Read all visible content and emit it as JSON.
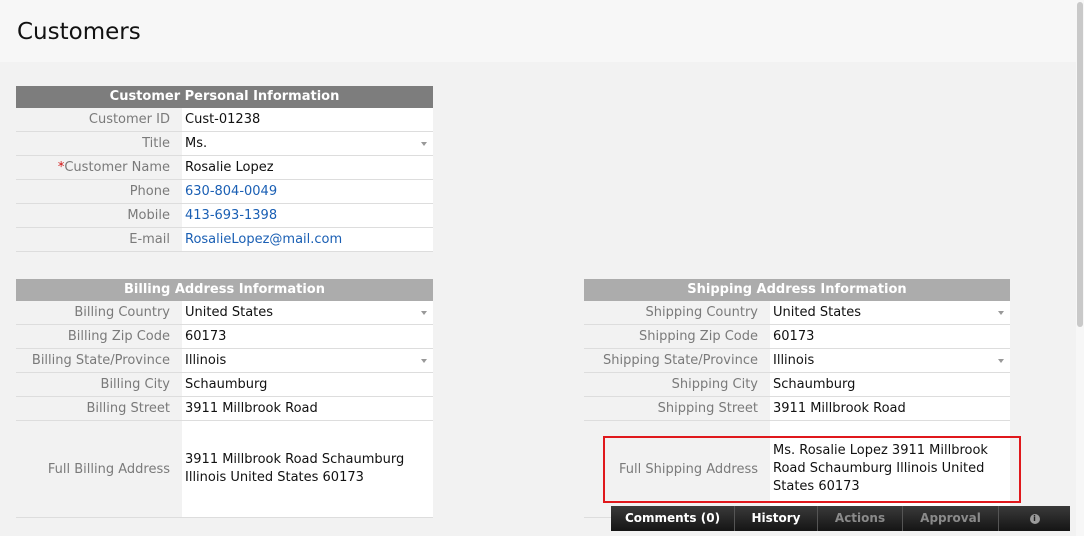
{
  "page": {
    "title": "Customers"
  },
  "personal": {
    "header": "Customer Personal Information",
    "rows": [
      {
        "label": "Customer ID",
        "value": "Cust-01238"
      },
      {
        "label": "Title",
        "value": "Ms."
      },
      {
        "required_mark": "*",
        "label": "Customer Name",
        "value": "Rosalie Lopez"
      },
      {
        "label": "Phone",
        "value": "630-804-0049"
      },
      {
        "label": "Mobile",
        "value": "413-693-1398"
      },
      {
        "label": "E-mail",
        "value": "RosalieLopez@mail.com"
      }
    ]
  },
  "billing": {
    "header": "Billing Address Information",
    "rows": [
      {
        "label": "Billing Country",
        "value": "United States"
      },
      {
        "label": "Billing Zip Code",
        "value": "60173"
      },
      {
        "label": "Billing State/Province",
        "value": "Illinois"
      },
      {
        "label": "Billing City",
        "value": "Schaumburg"
      },
      {
        "label": "Billing Street",
        "value": "3911 Millbrook Road"
      },
      {
        "label": "Full Billing Address",
        "value": "3911 Millbrook Road Schaumburg Illinois United States 60173"
      }
    ]
  },
  "shipping": {
    "header": "Shipping Address Information",
    "rows": [
      {
        "label": "Shipping Country",
        "value": "United States"
      },
      {
        "label": "Shipping Zip Code",
        "value": "60173"
      },
      {
        "label": "Shipping State/Province",
        "value": "Illinois"
      },
      {
        "label": "Shipping City",
        "value": "Schaumburg"
      },
      {
        "label": "Shipping Street",
        "value": "3911 Millbrook Road"
      },
      {
        "label": "Full Shipping Address",
        "value": "Ms.  Rosalie Lopez 3911 Millbrook Road Schaumburg Illinois United States 60173"
      }
    ]
  },
  "bottom_tabs": {
    "comments": "Comments (0)",
    "history": "History",
    "actions": "Actions",
    "approval": "Approval",
    "info_icon": "i"
  },
  "colors": {
    "highlight_border": "#e0181c",
    "link": "#1a5fb4",
    "required": "#d01010",
    "section_header_dark": "#7d7d7d",
    "section_header_light": "#acacac"
  }
}
